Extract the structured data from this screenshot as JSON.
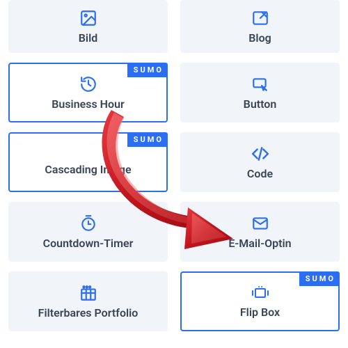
{
  "badge_text": "SUMO",
  "modules": [
    {
      "label": "Bild",
      "selected": false,
      "sumo": false
    },
    {
      "label": "Blog",
      "selected": false,
      "sumo": false
    },
    {
      "label": "Business Hour",
      "selected": true,
      "sumo": true
    },
    {
      "label": "Button",
      "selected": false,
      "sumo": false
    },
    {
      "label": "Cascading Image",
      "selected": true,
      "sumo": true
    },
    {
      "label": "Code",
      "selected": false,
      "sumo": false
    },
    {
      "label": "Countdown-Timer",
      "selected": false,
      "sumo": false
    },
    {
      "label": "E-Mail-Optin",
      "selected": false,
      "sumo": false
    },
    {
      "label": "Filterbares Portfolio",
      "selected": false,
      "sumo": false
    },
    {
      "label": "Flip Box",
      "selected": true,
      "sumo": true
    }
  ]
}
